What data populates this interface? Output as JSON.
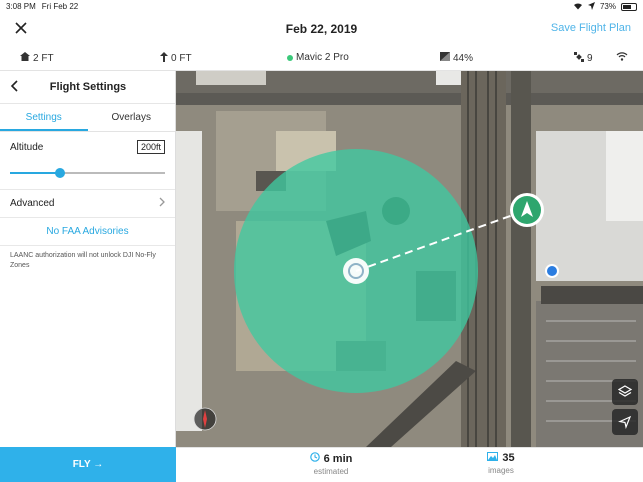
{
  "status_bar": {
    "time": "3:08 PM",
    "date": "Fri Feb 22",
    "battery": "73%",
    "battery_level": 0.73
  },
  "header": {
    "title": "Feb 22, 2019",
    "save_label": "Save Flight Plan"
  },
  "telemetry": {
    "home_alt": "2 FT",
    "rel_alt": "0 FT",
    "drone": "Mavic 2 Pro",
    "battery": "44%",
    "satellites": "9"
  },
  "sidebar": {
    "title": "Flight Settings",
    "tabs": [
      {
        "label": "Settings"
      },
      {
        "label": "Overlays"
      }
    ],
    "altitude_label": "Altitude",
    "altitude_value": "200ft",
    "altitude_level": 0.32,
    "advanced_label": "Advanced",
    "faa_label": "No FAA Advisories",
    "laanc_note": "LAANC authorization will not unlock DJI No-Fly Zones"
  },
  "fly_button": "FLY →",
  "stats": {
    "time_value": "6 min",
    "time_label": "estimated",
    "images_value": "35",
    "images_label": "images"
  },
  "colors": {
    "accent": "#2fb1ea",
    "zone": "#3fc9a0",
    "drone_marker": "#2ea66e"
  }
}
